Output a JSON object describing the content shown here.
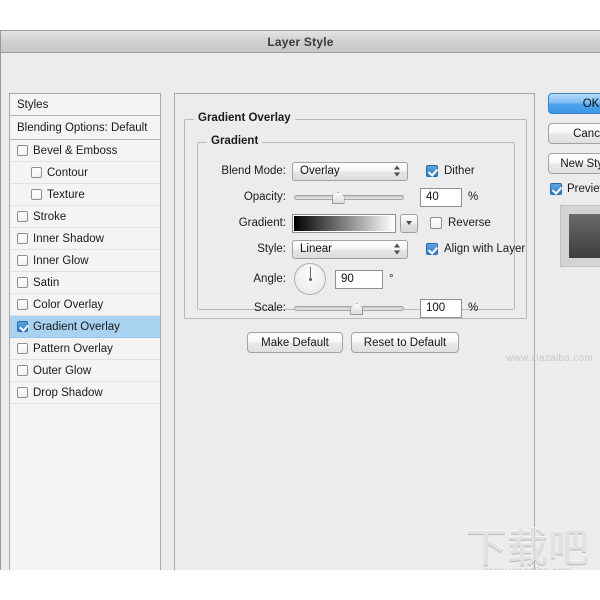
{
  "window": {
    "title": "Layer Style"
  },
  "styles_panel": {
    "header": "Styles",
    "blending_options": "Blending Options: Default",
    "effects": [
      {
        "label": "Bevel & Emboss",
        "checked": false,
        "sub": false,
        "selected": false
      },
      {
        "label": "Contour",
        "checked": false,
        "sub": true,
        "selected": false
      },
      {
        "label": "Texture",
        "checked": false,
        "sub": true,
        "selected": false
      },
      {
        "label": "Stroke",
        "checked": false,
        "sub": false,
        "selected": false
      },
      {
        "label": "Inner Shadow",
        "checked": false,
        "sub": false,
        "selected": false
      },
      {
        "label": "Inner Glow",
        "checked": false,
        "sub": false,
        "selected": false
      },
      {
        "label": "Satin",
        "checked": false,
        "sub": false,
        "selected": false
      },
      {
        "label": "Color Overlay",
        "checked": false,
        "sub": false,
        "selected": false
      },
      {
        "label": "Gradient Overlay",
        "checked": true,
        "sub": false,
        "selected": true
      },
      {
        "label": "Pattern Overlay",
        "checked": false,
        "sub": false,
        "selected": false
      },
      {
        "label": "Outer Glow",
        "checked": false,
        "sub": false,
        "selected": false
      },
      {
        "label": "Drop Shadow",
        "checked": false,
        "sub": false,
        "selected": false
      }
    ]
  },
  "main_panel": {
    "group_title": "Gradient Overlay",
    "subgroup_title": "Gradient",
    "blend_mode": {
      "label": "Blend Mode:",
      "value": "Overlay"
    },
    "dither": {
      "label": "Dither",
      "checked": true
    },
    "opacity": {
      "label": "Opacity:",
      "value": "40",
      "unit": "%",
      "percent": 40
    },
    "gradient": {
      "label": "Gradient:",
      "from": "#000000",
      "to": "#ffffff"
    },
    "reverse": {
      "label": "Reverse",
      "checked": false
    },
    "style": {
      "label": "Style:",
      "value": "Linear"
    },
    "align_with_layer": {
      "label": "Align with Layer",
      "checked": true
    },
    "angle": {
      "label": "Angle:",
      "value": "90",
      "unit": "°",
      "degrees": 90
    },
    "scale": {
      "label": "Scale:",
      "value": "100",
      "unit": "%",
      "percent": 100
    },
    "make_default": "Make Default",
    "reset_to_default": "Reset to Default"
  },
  "right_column": {
    "ok": "OK",
    "cancel": "Cancel",
    "new_style": "New Style...",
    "preview": {
      "label": "Preview",
      "checked": true
    }
  },
  "watermark": {
    "small": "www.xiazaiba.com",
    "cjk": "下载吧",
    "url": "www.xiazaiba.com"
  },
  "colors": {
    "accent": "#3d97e6",
    "selection": "#a8d2f0",
    "dialog_bg": "#ececec",
    "panel_bg": "#f4f4f4"
  }
}
